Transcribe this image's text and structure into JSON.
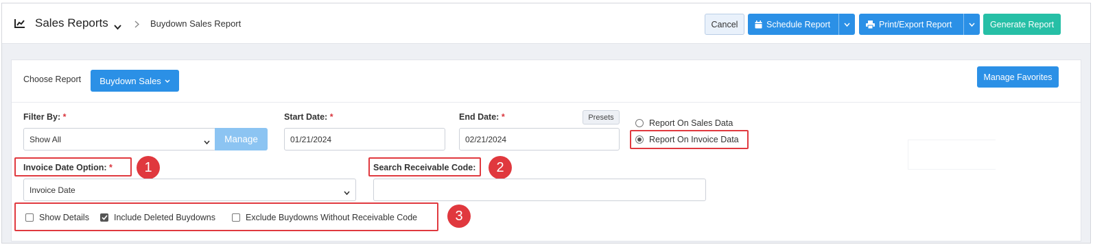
{
  "header": {
    "title": "Sales Reports",
    "breadcrumb": "Buydown Sales Report",
    "cancel_label": "Cancel",
    "schedule_label": "Schedule Report",
    "print_label": "Print/Export Report",
    "generate_label": "Generate Report"
  },
  "report": {
    "choose_label": "Choose Report",
    "selected_report": "Buydown Sales",
    "manage_favorites_label": "Manage Favorites"
  },
  "filters": {
    "filter_by_label": "Filter By:",
    "filter_by_value": "Show All",
    "manage_label": "Manage",
    "start_date_label": "Start Date:",
    "start_date_value": "01/21/2024",
    "end_date_label": "End Date:",
    "end_date_value": "02/21/2024",
    "presets_label": "Presets",
    "required_mark": "*",
    "report_on_sales": "Report On Sales Data",
    "report_on_invoice": "Report On Invoice Data",
    "invoice_date_option_label": "Invoice Date Option:",
    "invoice_date_option_value": "Invoice Date",
    "search_receivable_label": "Search Receivable Code:",
    "search_receivable_value": ""
  },
  "options": {
    "show_details": "Show Details",
    "include_deleted": "Include Deleted Buydowns",
    "exclude_without_code": "Exclude Buydowns Without Receivable Code"
  },
  "state": {
    "report_on": "invoice",
    "show_details_checked": false,
    "include_deleted_checked": true,
    "exclude_without_code_checked": false
  },
  "annotations": {
    "badge_1": "1",
    "badge_2": "2",
    "badge_3": "3"
  },
  "colors": {
    "primary": "#2b90e6",
    "success": "#26bfa6",
    "annotation": "#e0383e",
    "required": "#d9363e"
  }
}
